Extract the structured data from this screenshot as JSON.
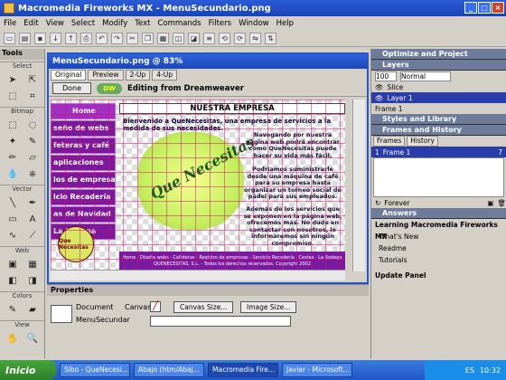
{
  "app": {
    "title": "Macromedia Fireworks MX - MenuSecundario.png"
  },
  "menu": [
    "File",
    "Edit",
    "View",
    "Select",
    "Modify",
    "Text",
    "Commands",
    "Filters",
    "Window",
    "Help"
  ],
  "tools": {
    "title": "Tools",
    "sections": [
      "Select",
      "Bitmap",
      "Vector",
      "Web",
      "Colors",
      "View"
    ]
  },
  "doc": {
    "title": "MenuSecundario.png @ 83%",
    "tabs": [
      "Original",
      "Preview",
      "2-Up",
      "4-Up"
    ],
    "done_label": "Done",
    "dw_logo": "DW",
    "editing_label": "Editing from Dreamweaver"
  },
  "canvas": {
    "nav": [
      "Home",
      "seño de webs",
      "feteras y café",
      "aplicaciones",
      "ios de empresa",
      "icio Recadería",
      "as de Navidad",
      "La Bodega"
    ],
    "banner": "NUESTRA EMPRESA",
    "welcome": "Bienvenido a QueNecesitas, una empresa de servicios a la medida de sus necesidades.",
    "bulb_text": "Que Necesitas",
    "right_p1": "Navegando por nuestra página web podrá encontrar como QueNecesitas puede hacer su vida más fácil.",
    "right_p2": "Podríamos suministrarle desde una máquina de café para su empresa hasta organizar un torneo social de pádel para sus empleados.",
    "right_p3": "Además de los servicios que se exponen en la página web, ofrecemos más. No dude en contactar con nosotros, le informaremos sin ningún compromiso.",
    "footer_line1": "Home · Diseño webs · Cafeteras · Registro de empresas · Servicio Recadería · Cestas · La Bodega",
    "footer_line2": "QUENECESITAS, S.L. - Todos los derechos reservados. Copyright 2002",
    "logo_small": "Que Necesitas"
  },
  "properties": {
    "title": "Properties",
    "doc_label": "Document",
    "doc_name": "MenuSecundar",
    "canvas_label": "Canvas:",
    "canvas_size_btn": "Canvas Size...",
    "image_size_btn": "Image Size..."
  },
  "panels": {
    "optimize": "Optimize and Project",
    "layers": "Layers",
    "opacity": "100",
    "blend": "Normal",
    "slice": "Slice",
    "layer1": "Layer 1",
    "frame1": "Frame 1",
    "styles": "Styles and Library",
    "frames_history": "Frames and History",
    "frames_tabs": [
      "Frames",
      "History"
    ],
    "frame_row_num": "1",
    "frame_row": "Frame 1",
    "frame_delay": "7",
    "forever": "Forever",
    "answers": "Answers",
    "learning": "Learning Macromedia Fireworks MX",
    "links": [
      "What's New",
      "Readme",
      "Tutorials"
    ],
    "update_panel": "Update Panel"
  },
  "taskbar": {
    "start": "Inicio",
    "tasks": [
      "Sibo - QueNecesi...",
      "Abajo (htm/Abaj...",
      "Macromedia Fire...",
      "Javier - Microsoft..."
    ],
    "lang": "ES",
    "clock": "10:32"
  }
}
